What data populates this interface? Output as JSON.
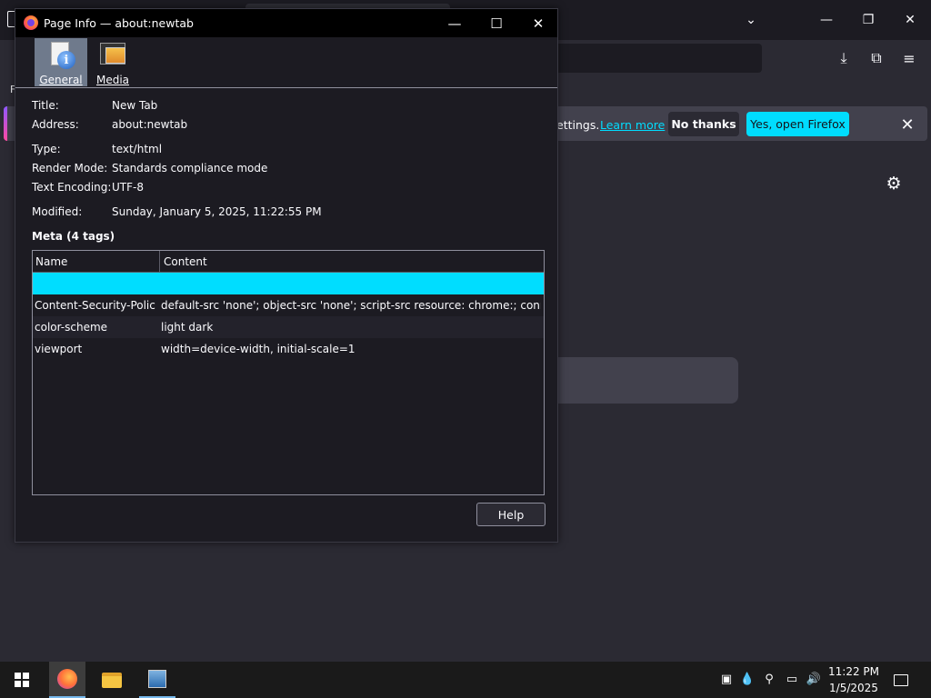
{
  "background": {
    "left_letter": "F",
    "notification": {
      "text": "ettings.",
      "learn_more": "Learn more",
      "no_thanks": "No thanks",
      "yes_open": "Yes, open Firefox"
    },
    "icons": {
      "tab_list": "chevron-down-icon",
      "minimize": "minimize-icon",
      "restore": "restore-icon",
      "close": "close-icon",
      "downloads": "download-icon",
      "extensions": "puzzle-icon",
      "menu": "hamburger-menu-icon",
      "settings": "gear-icon"
    },
    "accent": "#00ddff"
  },
  "dialog": {
    "title": "Page Info — about:newtab",
    "tabs": [
      {
        "label": "General",
        "selected": true
      },
      {
        "label": "Media",
        "selected": false
      }
    ],
    "fields": {
      "title": {
        "label": "Title:",
        "value": "New Tab"
      },
      "address": {
        "label": "Address:",
        "value": "about:newtab"
      },
      "type": {
        "label": "Type:",
        "value": "text/html"
      },
      "render_mode": {
        "label": "Render Mode:",
        "value": "Standards compliance mode"
      },
      "text_encoding": {
        "label": "Text Encoding:",
        "value": "UTF-8"
      },
      "modified": {
        "label": "Modified:",
        "value": "Sunday, January 5, 2025, 11:22:55 PM"
      }
    },
    "meta_heading": "Meta (4 tags)",
    "meta_table": {
      "columns": [
        "Name",
        "Content"
      ],
      "rows": [
        {
          "name": "",
          "content": ""
        },
        {
          "name": "Content-Security-Polic...",
          "content": "default-src 'none'; object-src 'none'; script-src resource: chrome:; connect-sr..."
        },
        {
          "name": "color-scheme",
          "content": "light dark"
        },
        {
          "name": "viewport",
          "content": "width=device-width, initial-scale=1"
        }
      ]
    },
    "help_label": "Help"
  },
  "taskbar": {
    "time": "11:22 PM",
    "date": "1/5/2025",
    "apps": [
      "firefox-icon",
      "file-explorer-icon",
      "server-manager-icon"
    ]
  }
}
